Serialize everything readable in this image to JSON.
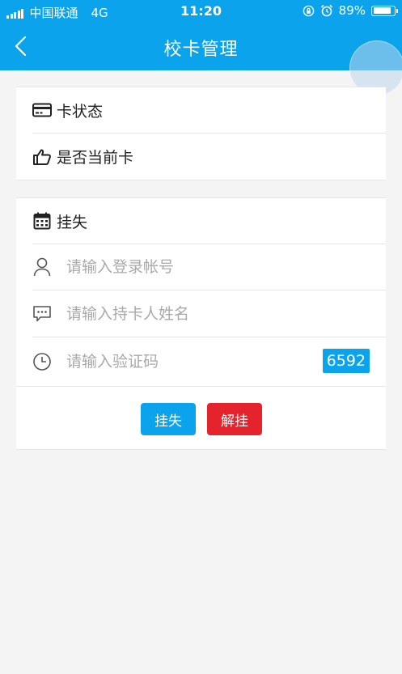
{
  "status_bar": {
    "carrier": "中国联通",
    "network": "4G",
    "time": "11:20",
    "battery": "89%",
    "battery_level": 0.89
  },
  "nav": {
    "title": "校卡管理",
    "back_icon": "chevron-left-icon"
  },
  "card_status": {
    "rows": [
      {
        "icon": "credit-card-icon",
        "label": "卡状态"
      },
      {
        "icon": "thumbs-up-icon",
        "label": "是否当前卡"
      }
    ]
  },
  "report_loss": {
    "header": {
      "icon": "calendar-icon",
      "label": "挂失"
    },
    "account_input": {
      "icon": "user-icon",
      "placeholder": "请输入登录帐号",
      "value": ""
    },
    "name_input": {
      "icon": "chat-bubble-icon",
      "placeholder": "请输入持卡人姓名",
      "value": ""
    },
    "code_input": {
      "icon": "clock-icon",
      "placeholder": "请输入验证码",
      "value": ""
    },
    "captcha": "6592",
    "buttons": {
      "report_label": "挂失",
      "unlock_label": "解挂"
    }
  },
  "colors": {
    "primary": "#0aa3ec",
    "danger": "#e5232d",
    "background": "#f4f4f4"
  }
}
